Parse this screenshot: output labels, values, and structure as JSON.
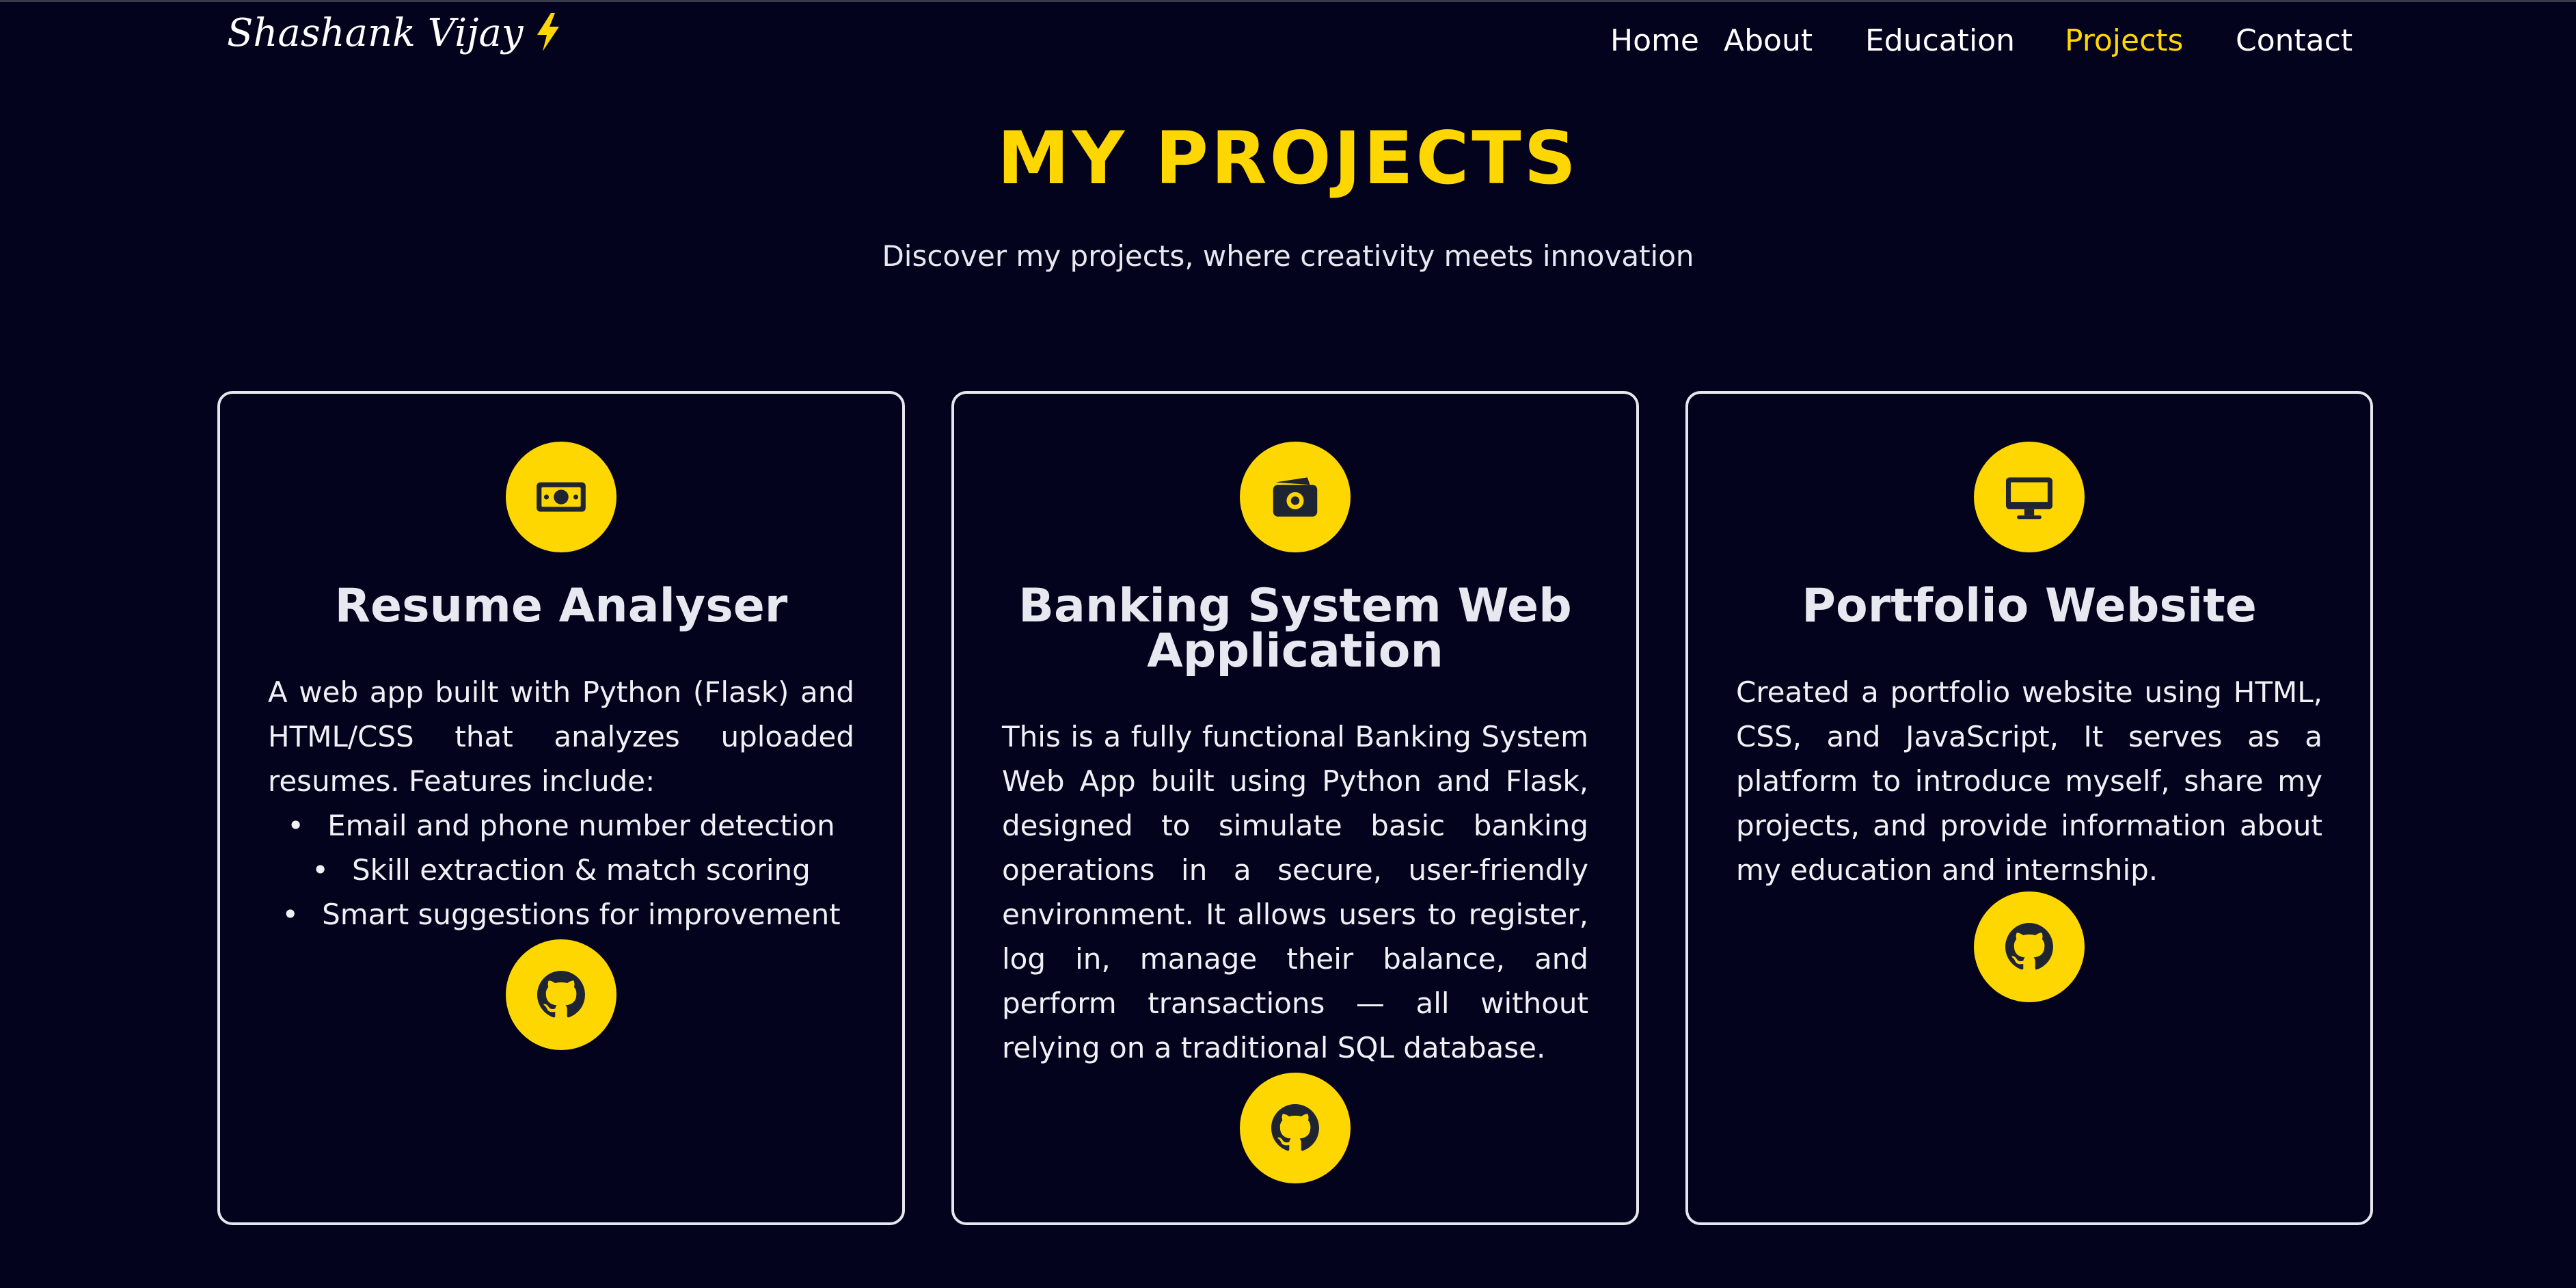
{
  "brand": {
    "name": "Shashank Vijay",
    "accent_color": "#ffd700",
    "background_color": "#03031e"
  },
  "nav": {
    "items": [
      {
        "label": "Home"
      },
      {
        "label": "About"
      },
      {
        "label": "Education"
      },
      {
        "label": "Projects",
        "active": true
      },
      {
        "label": "Contact"
      }
    ]
  },
  "page": {
    "title": "MY PROJECTS",
    "subtitle": "Discover my projects, where creativity meets innovation"
  },
  "projects": [
    {
      "icon": "money-bill-icon",
      "title": "Resume Analyser",
      "description": "A web app built with Python (Flask) and HTML/CSS that analyzes uploaded resumes. Features include:",
      "features": [
        "Email and phone number detection",
        "Skill extraction & match scoring",
        "Smart suggestions for improvement"
      ],
      "link_icon": "github-icon"
    },
    {
      "icon": "wallet-icon",
      "title": "Banking System Web Application",
      "description": "This is a fully functional Banking System Web App built using Python and Flask, designed to simulate basic banking operations in a secure, user-friendly environment. It allows users to register, log in, manage their balance, and perform transactions — all without relying on a traditional SQL database.",
      "link_icon": "github-icon"
    },
    {
      "icon": "desktop-icon",
      "title": "Portfolio Website",
      "description": "Created a portfolio website using HTML, CSS, and JavaScript, It serves as a platform to introduce myself, share my projects, and provide information about my education and internship.",
      "link_icon": "github-icon"
    }
  ]
}
